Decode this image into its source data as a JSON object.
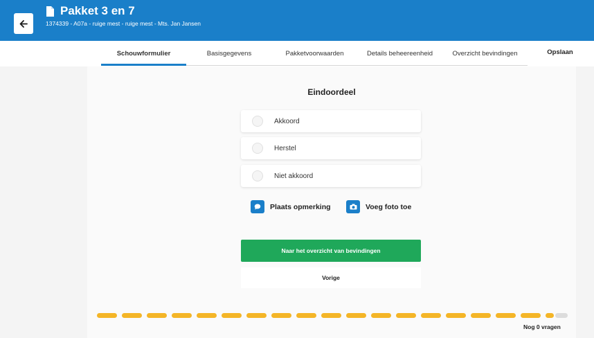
{
  "header": {
    "back_icon": "arrow-left-icon",
    "doc_icon": "document-icon",
    "title": "Pakket 3 en 7",
    "subtitle": "1374339 - A07a - ruige mest - ruige mest - Mts. Jan Jansen",
    "color": "#1a7fc9"
  },
  "tabs": [
    {
      "label": "Schouwformulier",
      "active": true
    },
    {
      "label": "Basisgegevens",
      "active": false
    },
    {
      "label": "Pakketvoorwaarden",
      "active": false
    },
    {
      "label": "Details beheereenheid",
      "active": false
    },
    {
      "label": "Overzicht bevindingen",
      "active": false
    }
  ],
  "save_label": "Opslaan",
  "form": {
    "section_title": "Eindoordeel",
    "options": [
      {
        "label": "Akkoord",
        "selected": false
      },
      {
        "label": "Herstel",
        "selected": false
      },
      {
        "label": "Niet akkoord",
        "selected": false
      }
    ],
    "remark_label": "Plaats opmerking",
    "remark_icon": "speech-bubble-icon",
    "photo_label": "Voeg foto toe",
    "photo_icon": "camera-icon",
    "primary_label": "Naar het overzicht van bevindingen",
    "primary_color": "#1fa85a",
    "secondary_label": "Vorige"
  },
  "progress": {
    "fraction": 1.0,
    "remaining_label": "Nog 0 vragen",
    "color": "#f4b527"
  }
}
